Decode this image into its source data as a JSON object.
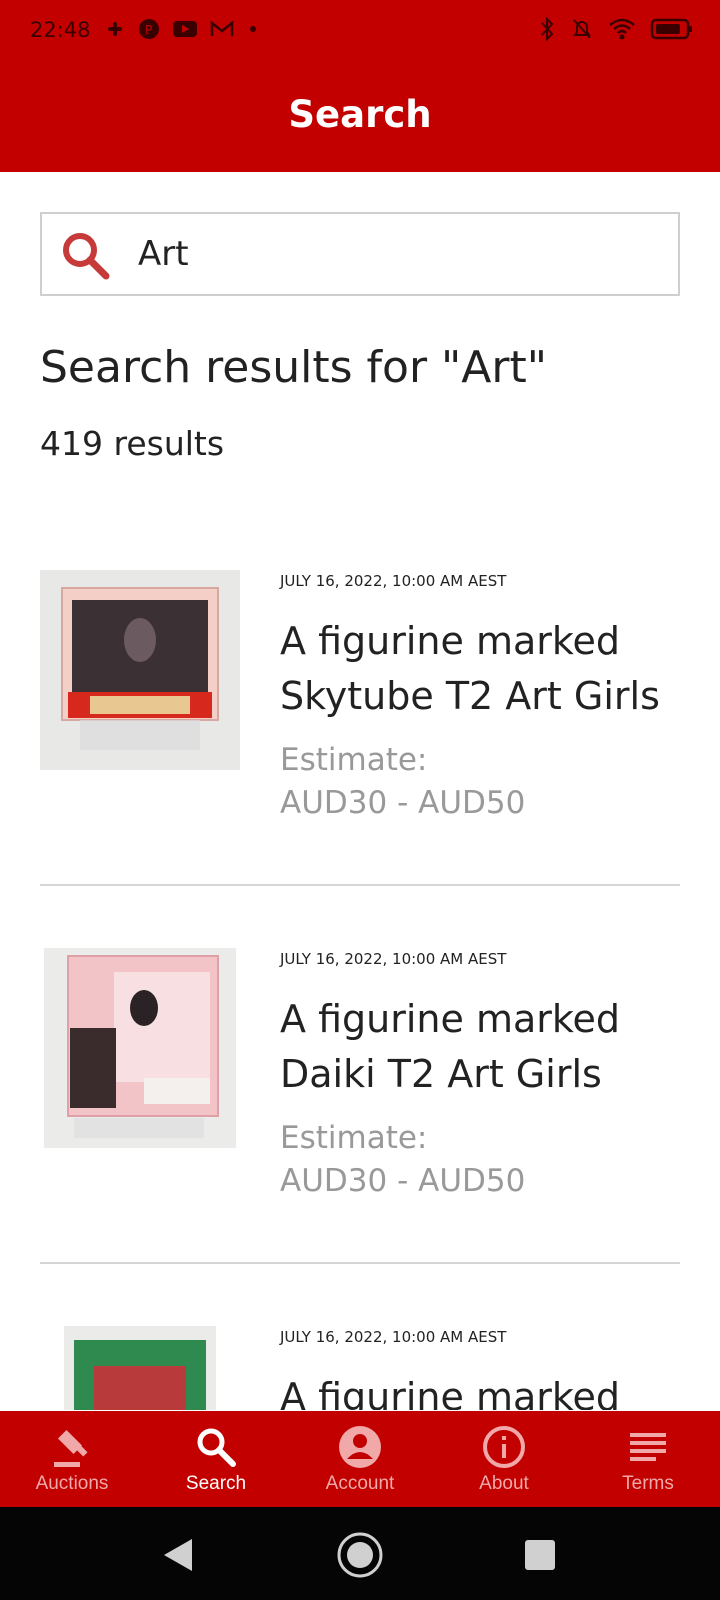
{
  "status_bar": {
    "time": "22:48"
  },
  "header": {
    "title": "Search"
  },
  "search": {
    "value": "Art",
    "icon": "search-icon"
  },
  "results": {
    "heading": "Search results for \"Art\"",
    "count_text": "419 results"
  },
  "items": [
    {
      "date": "JULY 16, 2022, 10:00 AM AEST",
      "title": "A figurine marked Skytube T2 Art Girls",
      "estimate_label": "Estimate:",
      "estimate_value": "AUD30 - AUD50"
    },
    {
      "date": "JULY 16, 2022, 10:00 AM AEST",
      "title": "A figurine marked Daiki T2 Art Girls",
      "estimate_label": "Estimate:",
      "estimate_value": "AUD30 - AUD50"
    },
    {
      "date": "JULY 16, 2022, 10:00 AM AEST",
      "title": "A figurine marked",
      "estimate_label": "",
      "estimate_value": ""
    }
  ],
  "bottom_nav": [
    {
      "label": "Auctions",
      "icon": "gavel-icon",
      "active": false
    },
    {
      "label": "Search",
      "icon": "search-icon",
      "active": true
    },
    {
      "label": "Account",
      "icon": "account-icon",
      "active": false
    },
    {
      "label": "About",
      "icon": "info-icon",
      "active": false
    },
    {
      "label": "Terms",
      "icon": "lines-icon",
      "active": false
    }
  ],
  "colors": {
    "brand": "#c20000",
    "active_nav_label": "#ffffff",
    "inactive_nav_label": "#f0a8a8",
    "muted_text": "#999999"
  }
}
